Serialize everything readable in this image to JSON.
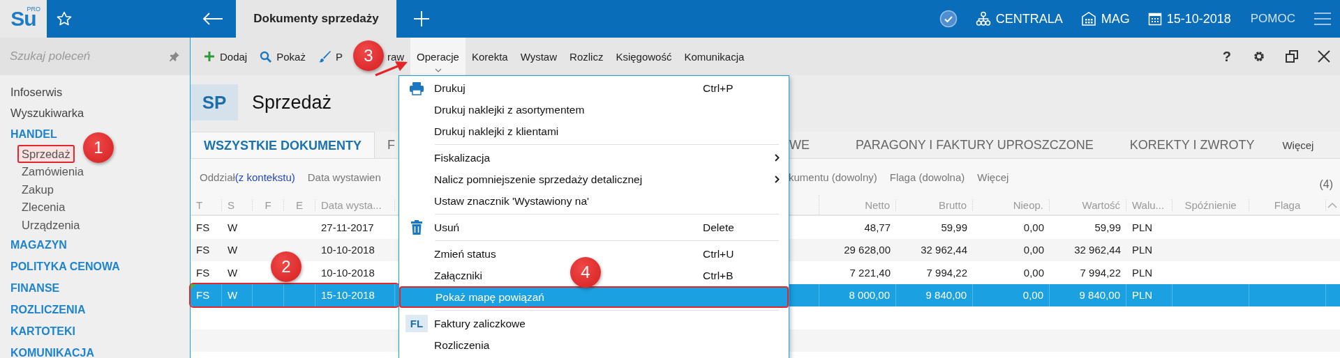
{
  "app": {
    "logo": "Su",
    "edition": "PRO"
  },
  "topbar": {
    "tab_title": "Dokumenty sprzedaży",
    "branch": "CENTRALA",
    "warehouse": "MAG",
    "date": "15-10-2018",
    "help": "POMOC"
  },
  "sidebar": {
    "search": {
      "placeholder": "Szukaj poleceń"
    },
    "items": [
      {
        "kind": "link",
        "label": "Infoserwis"
      },
      {
        "kind": "link",
        "label": "Wyszukiwarka"
      },
      {
        "kind": "section",
        "label": "HANDEL",
        "children": [
          {
            "label": "Sprzedaż",
            "outlined": true
          },
          {
            "label": "Zamówienia",
            "outlined": false
          },
          {
            "label": "Zakup",
            "outlined": false
          },
          {
            "label": "Zlecenia",
            "outlined": false
          },
          {
            "label": "Urządzenia",
            "outlined": false
          }
        ]
      },
      {
        "kind": "section",
        "label": "MAGAZYN"
      },
      {
        "kind": "section",
        "label": "POLITYKA CENOWA"
      },
      {
        "kind": "section",
        "label": "FINANSE"
      },
      {
        "kind": "section",
        "label": "ROZLICZENIA"
      },
      {
        "kind": "section",
        "label": "KARTOTEKI"
      },
      {
        "kind": "section",
        "label": "KOMUNIKACJA"
      }
    ]
  },
  "toolbar": {
    "items": [
      {
        "label": "Dodaj",
        "selected": false
      },
      {
        "label": "Pokaż",
        "selected": false
      },
      {
        "label": "P",
        "label_tail": "raw",
        "selected": false
      },
      {
        "label": "Operacje",
        "selected": true
      },
      {
        "label": "Korekta",
        "selected": false
      },
      {
        "label": "Wystaw",
        "selected": false
      },
      {
        "label": "Rozlicz",
        "selected": false
      },
      {
        "label": "Księgowość",
        "selected": false
      },
      {
        "label": "Komunikacja",
        "selected": false
      }
    ],
    "help": "?"
  },
  "module": {
    "badge": "SP",
    "title": "Sprzedaż"
  },
  "tabs": [
    {
      "label": "WSZYSTKIE DOKUMENTY",
      "selected": true
    },
    {
      "label": "F",
      "selected": false
    },
    {
      "label": "WE",
      "selected": false
    },
    {
      "label": "PARAGONY I FAKTURY UPROSZCZONE",
      "selected": false
    },
    {
      "label": "KOREKTY I ZWROTY",
      "selected": false
    }
  ],
  "tabs_more": "Więcej",
  "filters": [
    {
      "label": "Oddział",
      "value": "(z kontekstu)"
    },
    {
      "label": "Data wystawien"
    },
    {
      "label": "kumentu (dowolny)"
    },
    {
      "label": "Flaga (dowolna)"
    }
  ],
  "filters_more": "Więcej",
  "count": "(4)",
  "table": {
    "columns": [
      "T",
      "S",
      "F",
      "E",
      "Data wysta...",
      "Netto",
      "Brutto",
      "Nieop.",
      "Wartość",
      "Walu...",
      "Spóźnienie",
      "Flaga"
    ],
    "rows": [
      {
        "cells": [
          "FS",
          "W",
          "",
          "",
          "27-11-2017",
          "48,77",
          "59,99",
          "0,00",
          "59,99",
          "PLN",
          "",
          ""
        ],
        "selected": false,
        "outlined": false,
        "corner_mark": false
      },
      {
        "cells": [
          "FS",
          "W",
          "",
          "",
          "10-10-2018",
          "29 628,00",
          "32 962,44",
          "0,00",
          "32 962,44",
          "PLN",
          "",
          ""
        ],
        "selected": false,
        "outlined": false,
        "corner_mark": false
      },
      {
        "cells": [
          "FS",
          "W",
          "",
          "",
          "10-10-2018",
          "7 221,40",
          "7 994,22",
          "0,00",
          "7 994,22",
          "PLN",
          "",
          ""
        ],
        "selected": false,
        "outlined": false,
        "corner_mark": false
      },
      {
        "cells": [
          "FS",
          "W",
          "",
          "",
          "15-10-2018",
          "8 000,00",
          "9 840,00",
          "0,00",
          "9 840,00",
          "PLN",
          "",
          ""
        ],
        "selected": true,
        "outlined": true,
        "corner_mark": true
      }
    ]
  },
  "menu": {
    "groups": [
      [
        {
          "kind": "printer",
          "label": "Drukuj",
          "shortcut": "Ctrl+P",
          "submenu": false,
          "selected": false,
          "outlined": false
        },
        {
          "kind": "plain",
          "label": "Drukuj naklejki z asortymentem",
          "submenu": false,
          "selected": false,
          "outlined": false
        },
        {
          "kind": "plain",
          "label": "Drukuj naklejki z klientami",
          "submenu": false,
          "selected": false,
          "outlined": false
        }
      ],
      [
        {
          "kind": "plain",
          "label": "Fiskalizacja",
          "submenu": true,
          "selected": false,
          "outlined": false
        },
        {
          "kind": "plain",
          "label": "Nalicz pomniejszenie sprzedaży detalicznej",
          "submenu": true,
          "selected": false,
          "outlined": false
        },
        {
          "kind": "plain",
          "label": "Ustaw znacznik 'Wystawiony na'",
          "submenu": false,
          "selected": false,
          "outlined": false
        }
      ],
      [
        {
          "kind": "trash",
          "label": "Usuń",
          "shortcut": "Delete",
          "submenu": false,
          "selected": false,
          "outlined": false
        }
      ],
      [
        {
          "kind": "plain",
          "label": "Zmień status",
          "shortcut": "Ctrl+U",
          "submenu": false,
          "selected": false,
          "outlined": false
        },
        {
          "kind": "plain",
          "label": "Załączniki",
          "shortcut": "Ctrl+B",
          "submenu": false,
          "selected": false,
          "outlined": false
        },
        {
          "kind": "plain",
          "label": "Pokaż mapę powiązań",
          "submenu": false,
          "selected": true,
          "outlined": true
        }
      ],
      [
        {
          "kind": "badge",
          "badge": "FL",
          "label": "Faktury zaliczkowe",
          "submenu": false,
          "selected": false,
          "outlined": false
        },
        {
          "kind": "plain",
          "label": "Rozliczenia",
          "submenu": false,
          "selected": false,
          "outlined": false
        }
      ]
    ]
  },
  "annotations": [
    {
      "number": "1"
    },
    {
      "number": "2"
    },
    {
      "number": "3"
    },
    {
      "number": "4"
    }
  ]
}
